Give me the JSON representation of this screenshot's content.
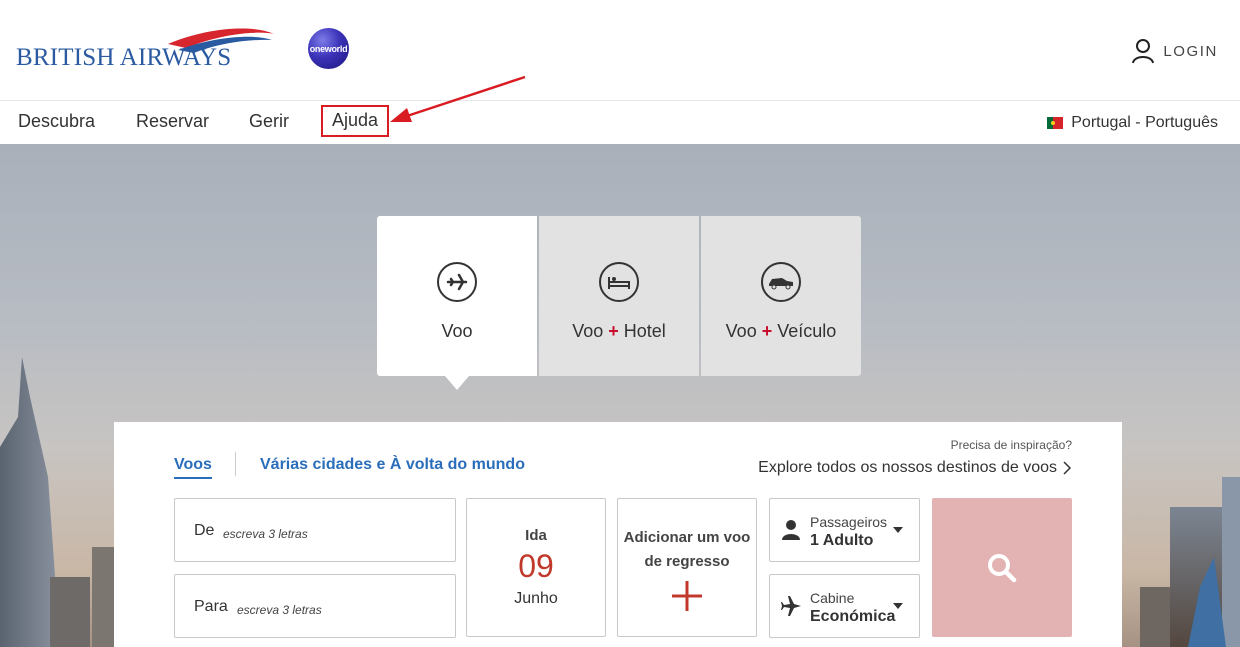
{
  "header": {
    "brand": "BRITISH AIRWAYS",
    "alliance": "oneworld",
    "login_label": "LOGIN"
  },
  "nav": {
    "items": [
      {
        "label": "Descubra"
      },
      {
        "label": "Reservar"
      },
      {
        "label": "Gerir"
      },
      {
        "label": "Ajuda"
      }
    ],
    "locale": "Portugal - Português"
  },
  "product_tabs": [
    {
      "label": "Voo",
      "icon": "plane-icon",
      "active": true
    },
    {
      "label_a": "Voo",
      "plus": "+",
      "label_b": "Hotel",
      "icon": "bed-icon"
    },
    {
      "label_a": "Voo",
      "plus": "+",
      "label_b": "Veículo",
      "icon": "car-icon"
    }
  ],
  "booking": {
    "sub_tabs": [
      "Voos",
      "Várias cidades e À volta do mundo"
    ],
    "inspiration_prompt": "Precisa de inspiração?",
    "explore_link": "Explore todos os nossos destinos de voos",
    "from": {
      "label": "De",
      "placeholder": "escreva 3 letras"
    },
    "to": {
      "label": "Para",
      "placeholder": "escreva 3 letras"
    },
    "departure": {
      "label": "Ida",
      "day": "09",
      "month": "Junho"
    },
    "return": {
      "label": "Adicionar um voo de regresso",
      "icon": "plus-icon"
    },
    "passengers": {
      "label": "Passageiros",
      "value": "1 Adulto"
    },
    "cabin": {
      "label": "Cabine",
      "value": "Económica"
    },
    "search": {
      "icon": "search-icon"
    }
  },
  "colors": {
    "brand_blue": "#2a5aa0",
    "accent_red": "#c8102e",
    "link_blue": "#2a6ebb",
    "search_button": "#e3b3b3",
    "annotation_red": "#d81c22"
  }
}
